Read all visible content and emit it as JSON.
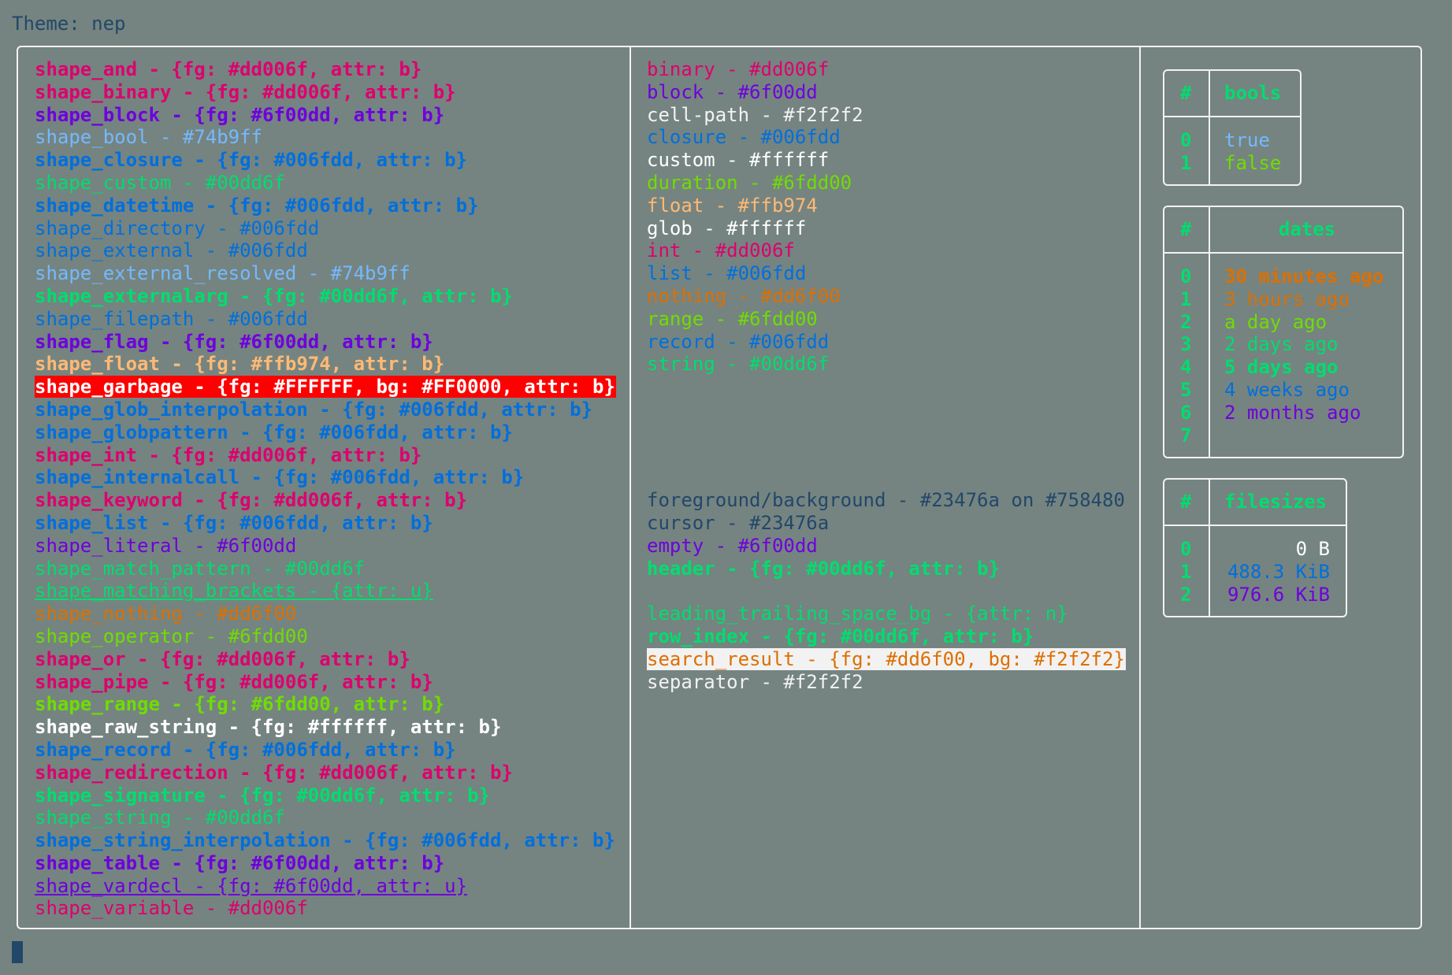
{
  "title": "Theme: nep",
  "colors": {
    "background": "#758480",
    "foreground": "#23476a",
    "border": "#f2f2f2"
  },
  "shape_lines": [
    {
      "text": "shape_and - {fg: #dd006f, attr: b}",
      "fg": "#dd006f",
      "bold": true
    },
    {
      "text": "shape_binary - {fg: #dd006f, attr: b}",
      "fg": "#dd006f",
      "bold": true
    },
    {
      "text": "shape_block - {fg: #6f00dd, attr: b}",
      "fg": "#6f00dd",
      "bold": true
    },
    {
      "text": "shape_bool - #74b9ff",
      "fg": "#74b9ff"
    },
    {
      "text": "shape_closure - {fg: #006fdd, attr: b}",
      "fg": "#006fdd",
      "bold": true
    },
    {
      "text": "shape_custom - #00dd6f",
      "fg": "#00dd6f"
    },
    {
      "text": "shape_datetime - {fg: #006fdd, attr: b}",
      "fg": "#006fdd",
      "bold": true
    },
    {
      "text": "shape_directory - #006fdd",
      "fg": "#006fdd"
    },
    {
      "text": "shape_external - #006fdd",
      "fg": "#006fdd"
    },
    {
      "text": "shape_external_resolved - #74b9ff",
      "fg": "#74b9ff"
    },
    {
      "text": "shape_externalarg - {fg: #00dd6f, attr: b}",
      "fg": "#00dd6f",
      "bold": true
    },
    {
      "text": "shape_filepath - #006fdd",
      "fg": "#006fdd"
    },
    {
      "text": "shape_flag - {fg: #6f00dd, attr: b}",
      "fg": "#6f00dd",
      "bold": true
    },
    {
      "text": "shape_float - {fg: #ffb974, attr: b}",
      "fg": "#ffb974",
      "bold": true
    },
    {
      "text": "shape_garbage - {fg: #FFFFFF, bg: #FF0000, attr: b}",
      "fg": "#FFFFFF",
      "bg": "#FF0000",
      "bold": true
    },
    {
      "text": "shape_glob_interpolation - {fg: #006fdd, attr: b}",
      "fg": "#006fdd",
      "bold": true
    },
    {
      "text": "shape_globpattern - {fg: #006fdd, attr: b}",
      "fg": "#006fdd",
      "bold": true
    },
    {
      "text": "shape_int - {fg: #dd006f, attr: b}",
      "fg": "#dd006f",
      "bold": true
    },
    {
      "text": "shape_internalcall - {fg: #006fdd, attr: b}",
      "fg": "#006fdd",
      "bold": true
    },
    {
      "text": "shape_keyword - {fg: #dd006f, attr: b}",
      "fg": "#dd006f",
      "bold": true
    },
    {
      "text": "shape_list - {fg: #006fdd, attr: b}",
      "fg": "#006fdd",
      "bold": true
    },
    {
      "text": "shape_literal - #6f00dd",
      "fg": "#6f00dd"
    },
    {
      "text": "shape_match_pattern - #00dd6f",
      "fg": "#00dd6f"
    },
    {
      "text": "shape_matching_brackets - {attr: u}",
      "fg": "#00dd6f",
      "underline": true
    },
    {
      "text": "shape_nothing - #dd6f00",
      "fg": "#dd6f00"
    },
    {
      "text": "shape_operator - #6fdd00",
      "fg": "#6fdd00"
    },
    {
      "text": "shape_or - {fg: #dd006f, attr: b}",
      "fg": "#dd006f",
      "bold": true
    },
    {
      "text": "shape_pipe - {fg: #dd006f, attr: b}",
      "fg": "#dd006f",
      "bold": true
    },
    {
      "text": "shape_range - {fg: #6fdd00, attr: b}",
      "fg": "#6fdd00",
      "bold": true
    },
    {
      "text": "shape_raw_string - {fg: #ffffff, attr: b}",
      "fg": "#ffffff",
      "bold": true
    },
    {
      "text": "shape_record - {fg: #006fdd, attr: b}",
      "fg": "#006fdd",
      "bold": true
    },
    {
      "text": "shape_redirection - {fg: #dd006f, attr: b}",
      "fg": "#dd006f",
      "bold": true
    },
    {
      "text": "shape_signature - {fg: #00dd6f, attr: b}",
      "fg": "#00dd6f",
      "bold": true
    },
    {
      "text": "shape_string - #00dd6f",
      "fg": "#00dd6f"
    },
    {
      "text": "shape_string_interpolation - {fg: #006fdd, attr: b}",
      "fg": "#006fdd",
      "bold": true
    },
    {
      "text": "shape_table - {fg: #6f00dd, attr: b}",
      "fg": "#6f00dd",
      "bold": true
    },
    {
      "text": "shape_vardecl - {fg: #6f00dd, attr: u}",
      "fg": "#6f00dd",
      "underline": true
    },
    {
      "text": "shape_variable - #dd006f",
      "fg": "#dd006f"
    }
  ],
  "type_lines": [
    {
      "text": "binary - #dd006f",
      "fg": "#dd006f"
    },
    {
      "text": "block - #6f00dd",
      "fg": "#6f00dd"
    },
    {
      "text": "cell-path - #f2f2f2",
      "fg": "#f2f2f2"
    },
    {
      "text": "closure - #006fdd",
      "fg": "#006fdd"
    },
    {
      "text": "custom - #ffffff",
      "fg": "#ffffff"
    },
    {
      "text": "duration - #6fdd00",
      "fg": "#6fdd00"
    },
    {
      "text": "float - #ffb974",
      "fg": "#ffb974"
    },
    {
      "text": "glob - #ffffff",
      "fg": "#ffffff"
    },
    {
      "text": "int - #dd006f",
      "fg": "#dd006f"
    },
    {
      "text": "list - #006fdd",
      "fg": "#006fdd"
    },
    {
      "text": "nothing - #dd6f00",
      "fg": "#dd6f00"
    },
    {
      "text": "range - #6fdd00",
      "fg": "#6fdd00"
    },
    {
      "text": "record - #006fdd",
      "fg": "#006fdd"
    },
    {
      "text": "string - #00dd6f",
      "fg": "#00dd6f"
    }
  ],
  "ui_lines": [
    {
      "text": "foreground/background - #23476a on #758480",
      "fg": "#23476a"
    },
    {
      "text": "cursor - #23476a",
      "fg": "#23476a"
    },
    {
      "text": "empty - #6f00dd",
      "fg": "#6f00dd"
    },
    {
      "text": "header - {fg: #00dd6f, attr: b}",
      "fg": "#00dd6f",
      "bold": true
    }
  ],
  "ui_lines2": [
    {
      "text": "leading_trailing_space_bg - {attr: n}",
      "fg": "#00dd6f"
    },
    {
      "text": "row_index - {fg: #00dd6f, attr: b}",
      "fg": "#00dd6f",
      "bold": true
    },
    {
      "text": "search_result - {fg: #dd6f00, bg: #f2f2f2}",
      "fg": "#dd6f00",
      "bg": "#f2f2f2"
    },
    {
      "text": "separator - #f2f2f2",
      "fg": "#f2f2f2"
    }
  ],
  "bools_table": {
    "index_header": "#",
    "header": "bools",
    "rows": [
      {
        "index": "0",
        "value": "true",
        "fg": "#74b9ff"
      },
      {
        "index": "1",
        "value": "false",
        "fg": "#6fdd00"
      }
    ]
  },
  "dates_table": {
    "index_header": "#",
    "header": "dates",
    "rows": [
      {
        "index": "0",
        "value": "30 minutes ago",
        "fg": "#dd6f00",
        "bold": true
      },
      {
        "index": "1",
        "value": "3 hours ago",
        "fg": "#dd6f00"
      },
      {
        "index": "2",
        "value": "a day ago",
        "fg": "#6fdd00"
      },
      {
        "index": "3",
        "value": "2 days ago",
        "fg": "#00dd6f"
      },
      {
        "index": "4",
        "value": "5 days ago",
        "fg": "#00dd6f",
        "bold": true
      },
      {
        "index": "5",
        "value": "4 weeks ago",
        "fg": "#006fdd"
      },
      {
        "index": "6",
        "value": "2 months ago",
        "fg": "#6f00dd"
      },
      {
        "index": "7",
        "value": "",
        "fg": "#00dd6f"
      }
    ]
  },
  "filesizes_table": {
    "index_header": "#",
    "header": "filesizes",
    "rows": [
      {
        "index": "0",
        "value": "0 B",
        "fg": "#ffffff"
      },
      {
        "index": "1",
        "value": "488.3 KiB",
        "fg": "#006fdd"
      },
      {
        "index": "2",
        "value": "976.6 KiB",
        "fg": "#6f00dd"
      }
    ]
  }
}
